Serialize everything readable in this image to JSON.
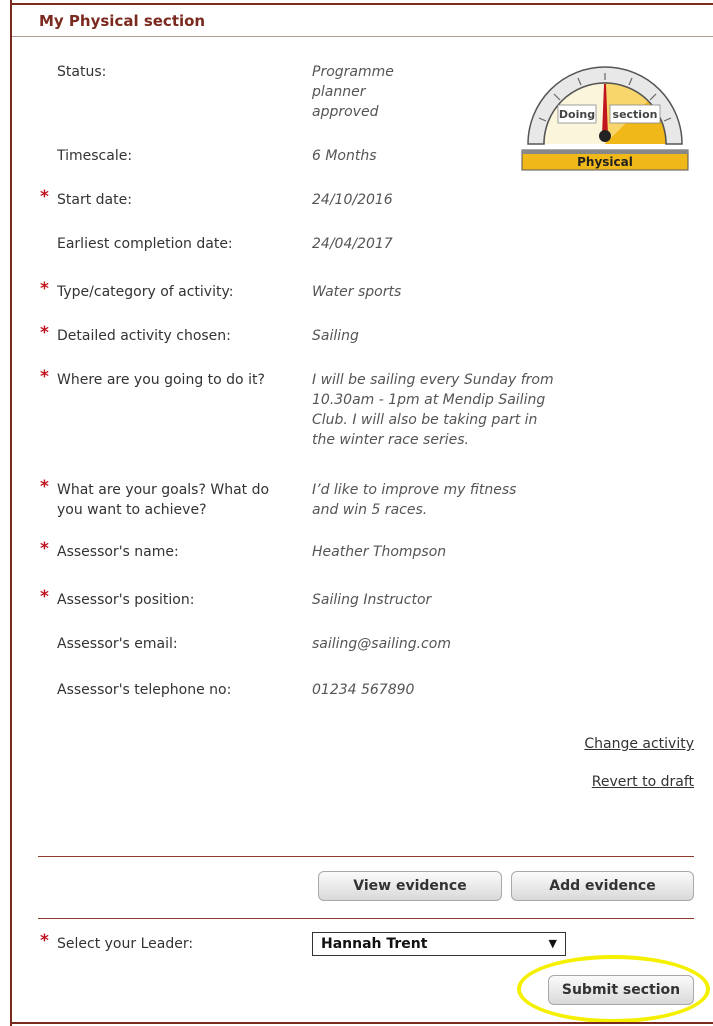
{
  "section": {
    "title": "My Physical section"
  },
  "gauge": {
    "label_left": "Doing",
    "label_right": "section",
    "banner": "Physical",
    "accent": "#f1b81a",
    "needle": "#c0141e"
  },
  "fields": [
    {
      "label": "Status:",
      "value": "Programme planner approved",
      "required": false
    },
    {
      "label": "Timescale:",
      "value": "6 Months",
      "required": false
    },
    {
      "label": "Start date:",
      "value": "24/10/2016",
      "required": true
    },
    {
      "label": "Earliest completion date:",
      "value": "24/04/2017",
      "required": false
    },
    {
      "label": "Type/category of activity:",
      "value": "Water sports",
      "required": true
    },
    {
      "label": "Detailed activity chosen:",
      "value": "Sailing",
      "required": true
    },
    {
      "label": "Where are you going to do it?",
      "value": "I will be sailing every Sunday from 10.30am - 1pm at Mendip Sailing Club. I will also be taking part in the winter race series.",
      "required": true
    },
    {
      "label": "What are your goals? What do you want to achieve?",
      "value": "I’d like to improve my fitness and win 5 races.",
      "required": true
    },
    {
      "label": "Assessor's name:",
      "value": "Heather Thompson",
      "required": true
    },
    {
      "label": "Assessor's position:",
      "value": "Sailing Instructor",
      "required": true
    },
    {
      "label": "Assessor's email:",
      "value": "sailing@sailing.com",
      "required": false
    },
    {
      "label": "Assessor's telephone no:",
      "value": "01234 567890",
      "required": false
    }
  ],
  "links": {
    "change_activity": "Change activity",
    "revert_to_draft": "Revert to draft"
  },
  "buttons": {
    "view_evidence": "View evidence",
    "add_evidence": "Add evidence",
    "submit_section": "Submit section"
  },
  "leader": {
    "label": "Select your Leader:",
    "selected": "Hannah Trent",
    "required": true
  },
  "required_mark": "*"
}
